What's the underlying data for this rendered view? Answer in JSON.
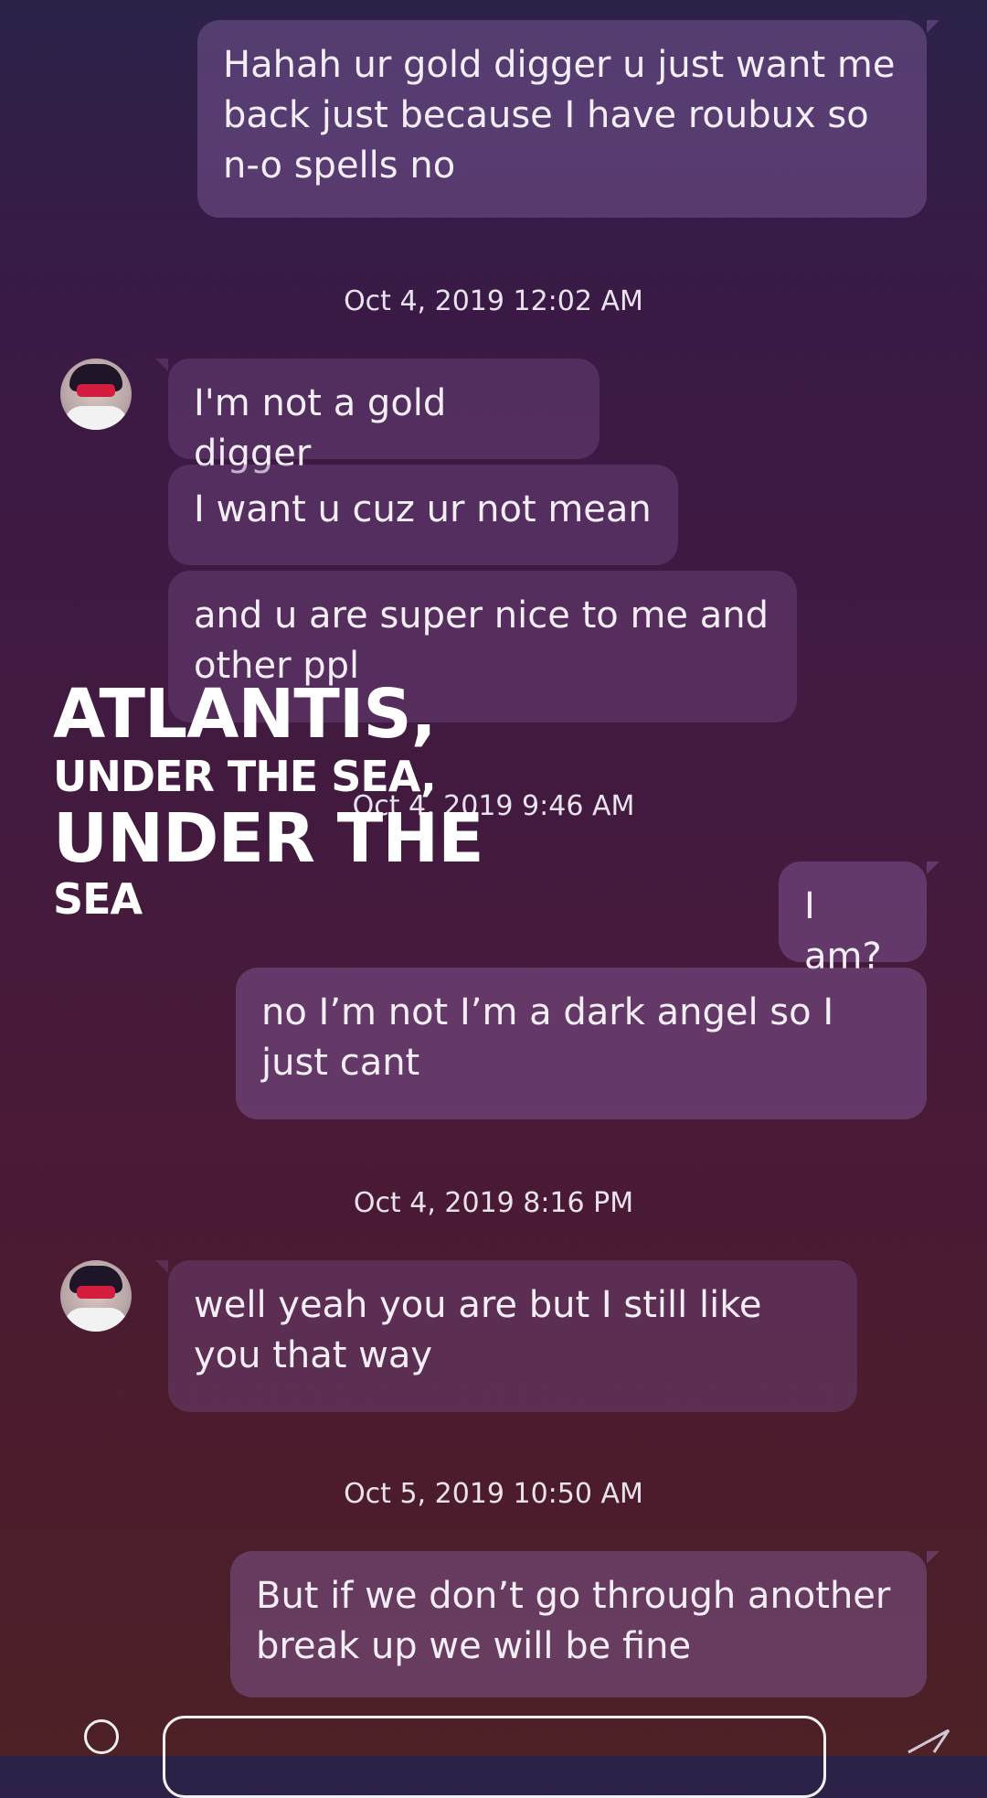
{
  "messages": {
    "m1": "Hahah ur gold digger u just want me back just because I have roubux so n-o spells no",
    "m2": "I'm not a gold digger",
    "m3": "I want u cuz ur not mean",
    "m4": "and u are super nice to me and other ppl",
    "m5": "I am?",
    "m6": "no I’m not I’m a dark angel so I just cant",
    "m7": "well yeah you are but I still like you that way",
    "m8": "But if we don’t go through another break up we will be fine"
  },
  "timestamps": {
    "t1": "Oct 4, 2019 12:02 AM",
    "t2": "Oct 4, 2019 9:46 AM",
    "t3": "Oct 4, 2019 8:16 PM",
    "t4": "Oct 5, 2019 10:50 AM"
  },
  "overlay": {
    "line1": "ATLANTIS,",
    "line2": "UNDER THE SEA,",
    "line3": "UNDER THE",
    "line4": "SEA"
  },
  "icons": {
    "send": "send-icon",
    "avatar": "avatar-icon"
  }
}
